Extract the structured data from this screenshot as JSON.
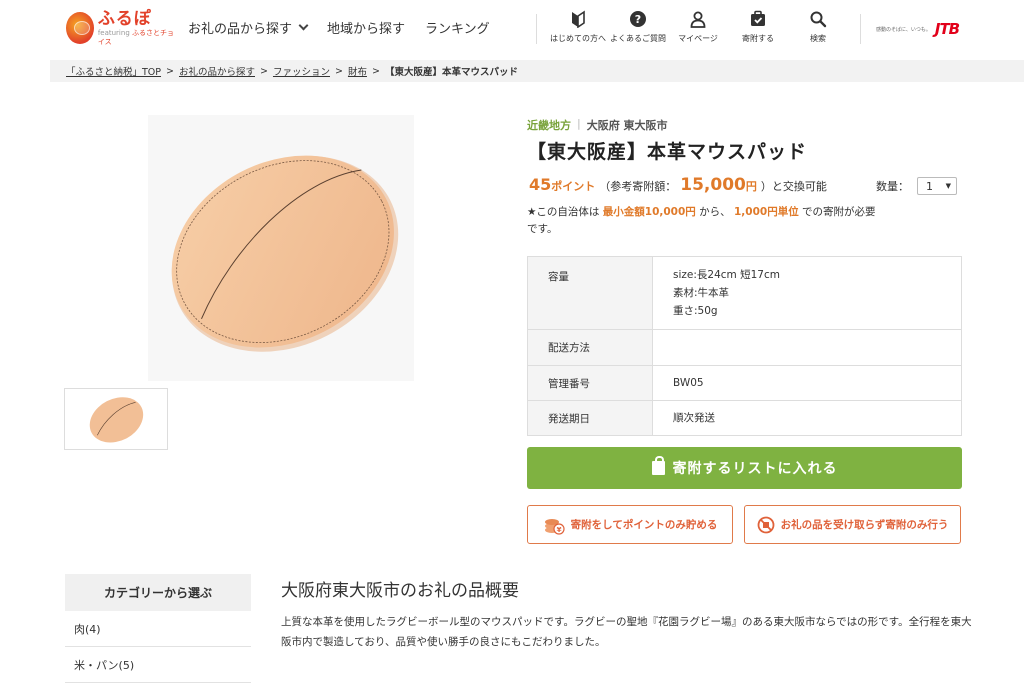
{
  "header": {
    "logo": {
      "main": "ふるぽ",
      "sub_prefix": "featuring",
      "sub_brand": "ふるさとチョイス"
    },
    "nav": [
      {
        "label": "お礼の品から探す",
        "has_dropdown": true
      },
      {
        "label": "地域から探す"
      },
      {
        "label": "ランキング"
      }
    ],
    "icons": [
      {
        "label": "はじめての方へ",
        "icon": "beginner-mark-icon"
      },
      {
        "label": "よくあるご質問",
        "icon": "question-icon"
      },
      {
        "label": "マイページ",
        "icon": "user-icon"
      },
      {
        "label": "寄附する",
        "icon": "donate-icon"
      },
      {
        "label": "検索",
        "icon": "search-icon"
      }
    ],
    "jtb": {
      "tagline": "感動のそばに、いつも。",
      "logo": "JTB"
    }
  },
  "breadcrumb": [
    {
      "label": "「ふるさと納税」TOP",
      "link": true
    },
    {
      "label": "お礼の品から探す",
      "link": true
    },
    {
      "label": "ファッション",
      "link": true
    },
    {
      "label": "財布",
      "link": true
    },
    {
      "label": "【東大阪産】本革マウスパッド",
      "link": false
    }
  ],
  "product": {
    "region_area": "近畿地方",
    "region_city": "大阪府 東大阪市",
    "title": "【東大阪産】本革マウスパッド",
    "points_value": "45",
    "points_unit": "ポイント",
    "price_prefix": "（参考寄附額：",
    "price_value": "15,000",
    "price_unit": "円",
    "price_suffix": "）と交換可能",
    "qty_label": "数量：",
    "qty_value": "1",
    "note_part1": "★この自治体は",
    "note_min": "最小金額10,000円",
    "note_part2": "から、",
    "note_unit": "1,000円単位",
    "note_part3": "での寄附が必要です。"
  },
  "spec": [
    {
      "key": "容量",
      "lines": [
        "size:長24cm 短17cm",
        "素材:牛本革",
        "重さ:50g"
      ]
    },
    {
      "key": "配送方法",
      "lines": [
        ""
      ]
    },
    {
      "key": "管理番号",
      "lines": [
        "BW05"
      ]
    },
    {
      "key": "発送期日",
      "lines": [
        "順次発送"
      ]
    }
  ],
  "buttons": {
    "add_to_list": "寄附するリストに入れる",
    "points_only": "寄附をしてポイントのみ貯める",
    "no_gift": "お礼の品を受け取らず寄附のみ行う"
  },
  "sidebar": {
    "heading": "カテゴリーから選ぶ",
    "items": [
      "肉(4)",
      "米・パン(5)"
    ]
  },
  "overview": {
    "title": "大阪府東大阪市のお礼の品概要",
    "text": "上質な本革を使用したラグビーボール型のマウスパッドです。ラグビーの聖地『花園ラグビー場』のある東大阪市ならではの形です。全行程を東大阪市内で製造しており、品質や使い勝手の良さにもこだわりました。"
  },
  "colors": {
    "accent_green": "#7fb241",
    "accent_orange": "#e07a2a",
    "region_green": "#7aa33c",
    "leather": "#f2bf96"
  }
}
